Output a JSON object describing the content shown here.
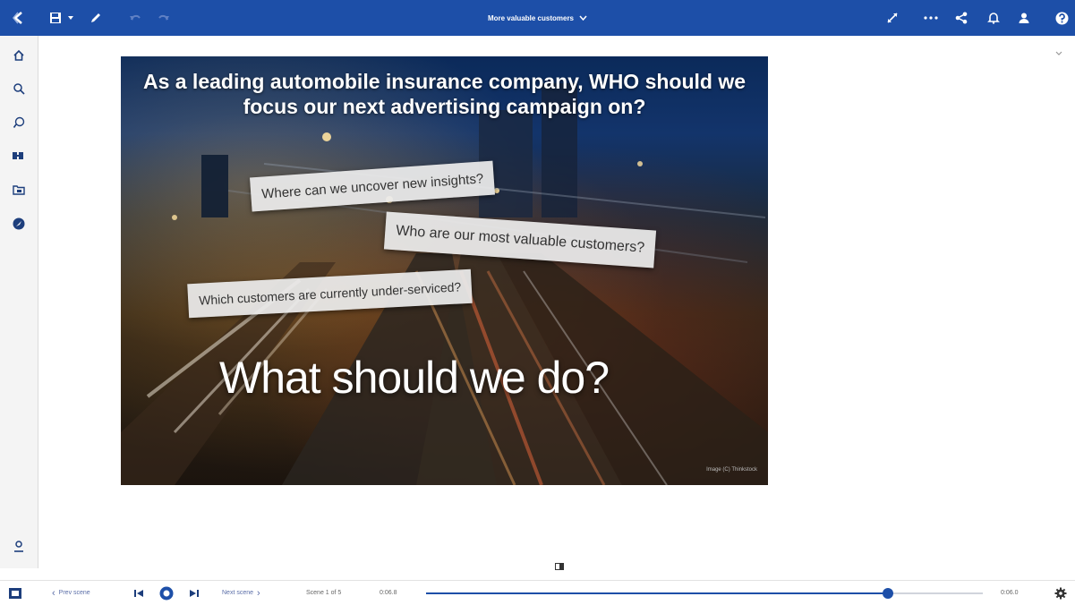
{
  "app": {
    "title": "More valuable customers",
    "accent_color": "#1d4fa8"
  },
  "toolbar": {
    "left_icons": [
      "back-icon",
      "save-icon",
      "save-menu-chevron-icon",
      "edit-pencil-icon",
      "undo-icon",
      "redo-icon"
    ],
    "right_icons": [
      "expand-icon",
      "more-icon",
      "share-icon",
      "notification-icon",
      "user-icon",
      "help-icon"
    ]
  },
  "sidebar": {
    "items": [
      "home-icon",
      "search-icon",
      "assistant-icon",
      "data-icon",
      "folder-icon",
      "navigate-icon"
    ],
    "bottom_item": "user-settings-icon"
  },
  "slide": {
    "headline": "As a leading automobile insurance company, WHO should we focus our next advertising campaign on?",
    "questions": [
      "Where can we uncover new insights?",
      "Who are our most valuable customers?",
      "Which customers are currently under-serviced?"
    ],
    "big_question": "What should we do?",
    "credit": "Image (C) Thinkstock"
  },
  "playback": {
    "prev_label": "Prev scene",
    "next_label": "Next scene",
    "scene_label": "Scene 1 of 5",
    "current_time": "0:06.8",
    "end_time": "0:06.0",
    "progress": 0.83
  }
}
